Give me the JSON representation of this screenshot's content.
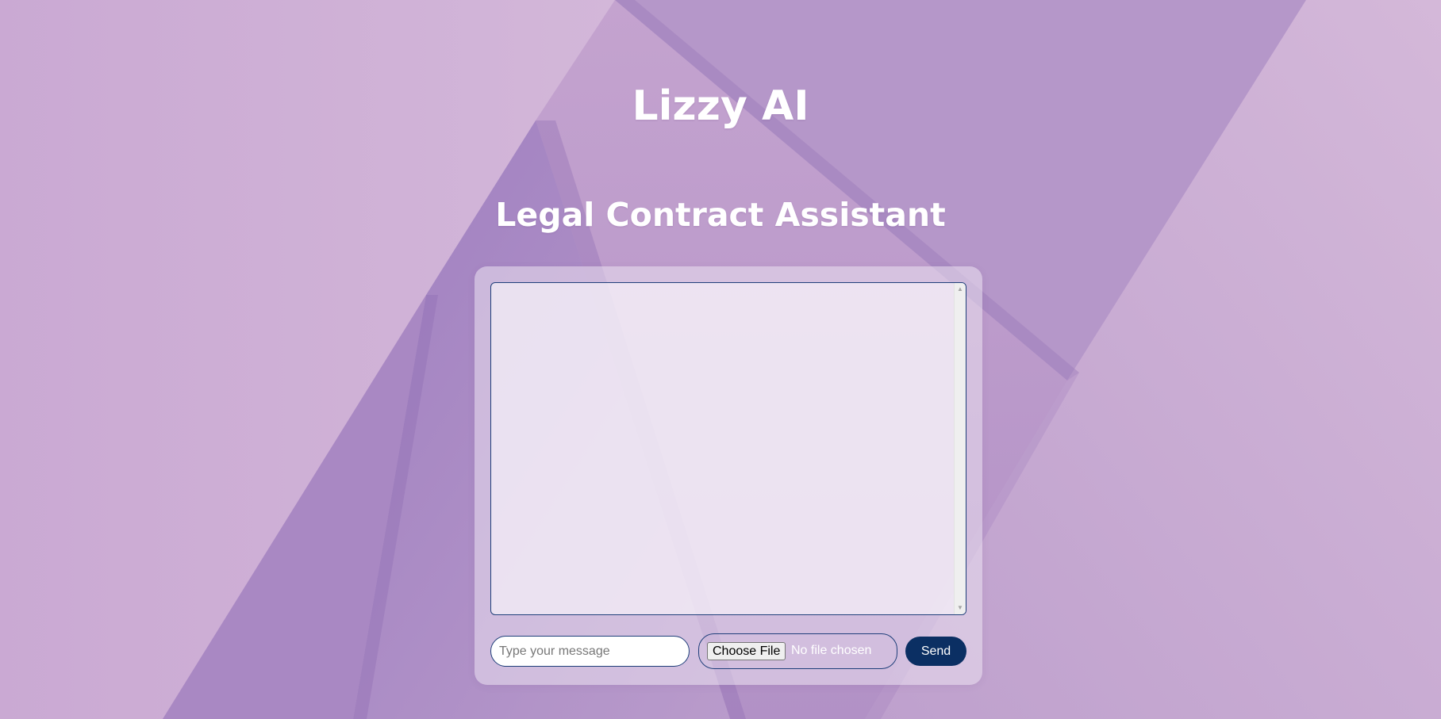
{
  "app": {
    "title": "Lizzy AI",
    "subtitle": "Legal Contract Assistant"
  },
  "chat": {
    "messages": []
  },
  "composer": {
    "message_placeholder": "Type your message",
    "message_value": "",
    "file_button_label": "Choose File",
    "file_status": "No file chosen",
    "send_label": "Send"
  },
  "colors": {
    "accent": "#0b2f63",
    "border": "#1f3f7a",
    "text_on_bg": "#ffffff",
    "background": "#bfa3cd"
  },
  "icons": {
    "scroll_up": "scroll-up-arrow-icon",
    "scroll_down": "scroll-down-arrow-icon"
  }
}
